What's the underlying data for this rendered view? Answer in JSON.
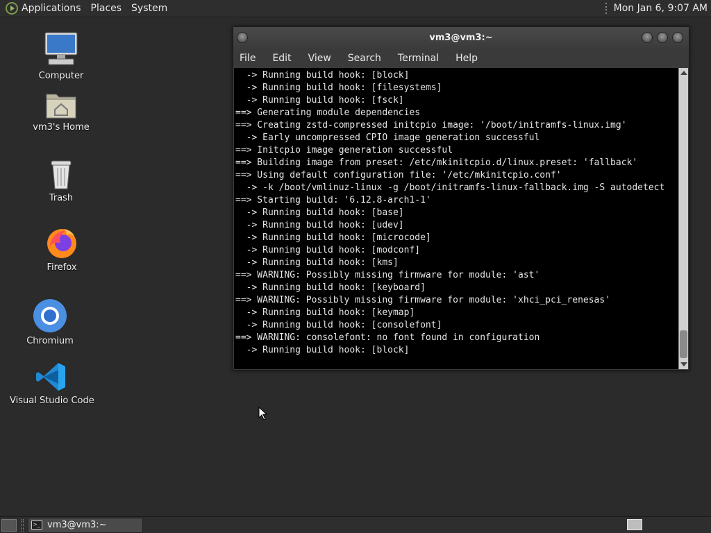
{
  "top_panel": {
    "menus": [
      "Applications",
      "Places",
      "System"
    ],
    "clock": "Mon Jan  6,  9:07 AM"
  },
  "desktop_icons": [
    {
      "label": "Computer",
      "icon": "computer-icon"
    },
    {
      "label": "vm3's Home",
      "icon": "home-folder-icon"
    },
    {
      "label": "Trash",
      "icon": "trash-icon"
    },
    {
      "label": "Firefox",
      "icon": "firefox-icon"
    },
    {
      "label": "Chromium",
      "icon": "chromium-icon"
    },
    {
      "label": "Visual Studio Code",
      "icon": "vscode-icon"
    }
  ],
  "terminal": {
    "title": "vm3@vm3:~",
    "menu": [
      "File",
      "Edit",
      "View",
      "Search",
      "Terminal",
      "Help"
    ],
    "lines": [
      "  -> Running build hook: [block]",
      "  -> Running build hook: [filesystems]",
      "  -> Running build hook: [fsck]",
      "==> Generating module dependencies",
      "==> Creating zstd-compressed initcpio image: '/boot/initramfs-linux.img'",
      "  -> Early uncompressed CPIO image generation successful",
      "==> Initcpio image generation successful",
      "==> Building image from preset: /etc/mkinitcpio.d/linux.preset: 'fallback'",
      "==> Using default configuration file: '/etc/mkinitcpio.conf'",
      "  -> -k /boot/vmlinuz-linux -g /boot/initramfs-linux-fallback.img -S autodetect",
      "==> Starting build: '6.12.8-arch1-1'",
      "  -> Running build hook: [base]",
      "  -> Running build hook: [udev]",
      "  -> Running build hook: [microcode]",
      "  -> Running build hook: [modconf]",
      "  -> Running build hook: [kms]",
      "==> WARNING: Possibly missing firmware for module: 'ast'",
      "  -> Running build hook: [keyboard]",
      "==> WARNING: Possibly missing firmware for module: 'xhci_pci_renesas'",
      "  -> Running build hook: [keymap]",
      "  -> Running build hook: [consolefont]",
      "==> WARNING: consolefont: no font found in configuration",
      "  -> Running build hook: [block]"
    ]
  },
  "taskbar": {
    "task_label": "vm3@vm3:~"
  },
  "colors": {
    "desktop_bg": "#2b2b2b",
    "terminal_bg": "#000000",
    "panel_bg": "#2e2e2e"
  }
}
